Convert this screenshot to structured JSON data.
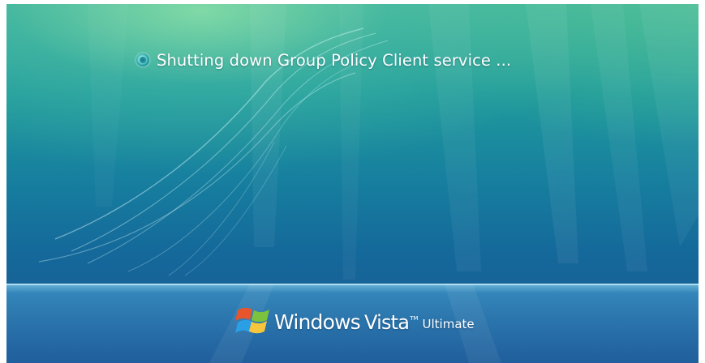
{
  "shutdown": {
    "status_message": "Shutting down Group Policy Client service ...",
    "progress_icon": "busy-spinner-icon"
  },
  "branding": {
    "logo_icon": "windows-flag-logo",
    "product_word_1": "Windows",
    "product_word_2": "Vista",
    "trademark": "TM",
    "edition": "Ultimate"
  },
  "colors": {
    "background_top": "#3fb39a",
    "background_mid": "#17809f",
    "background_bottom": "#1b5f98",
    "text": "#ffffff",
    "logo_red": "#e8542c",
    "logo_green": "#7cc23d",
    "logo_blue": "#2a9fe6",
    "logo_yellow": "#f7c63c"
  }
}
